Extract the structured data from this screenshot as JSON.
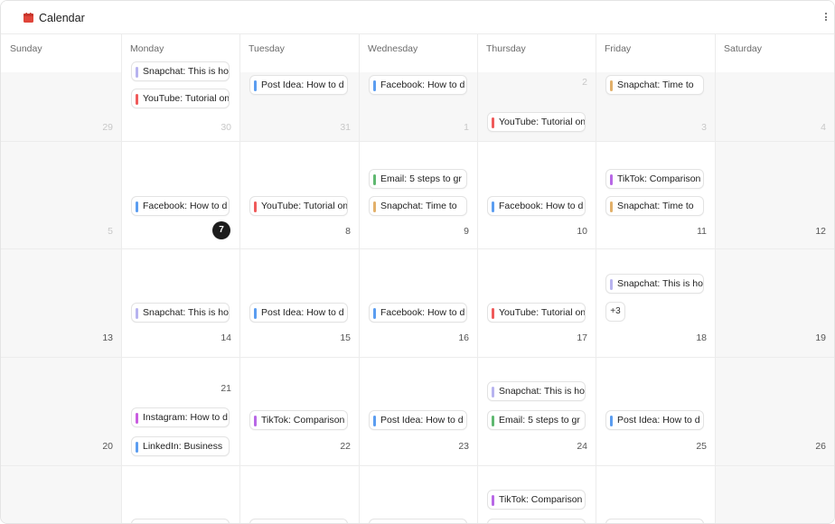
{
  "header": {
    "title": "Calendar"
  },
  "colors": {
    "facebook": "#5b9df0",
    "youtube": "#ef5a5a",
    "snapchat": "#b7b3ef",
    "email": "#5fb870",
    "snapchat_time": "#e2b06a",
    "tiktok": "#b868e6",
    "post": "#5b9df0",
    "instagram": "#c95ce0",
    "linkedin": "#5b9df0"
  },
  "weekdays": [
    "Sunday",
    "Monday",
    "Tuesday",
    "Wednesday",
    "Thursday",
    "Friday",
    "Saturday"
  ],
  "weeks": [
    {
      "days": [
        {
          "num": "29",
          "muted": true
        },
        {
          "num": "30",
          "muted": true
        },
        {
          "num": "31",
          "muted": true
        },
        {
          "num": "1",
          "muted": true
        },
        {
          "num": "2",
          "muted": true
        },
        {
          "num": "3",
          "muted": true
        },
        {
          "num": "4",
          "muted": true
        }
      ]
    },
    {
      "days": [
        {
          "num": "5",
          "muted": true
        },
        {
          "num": "7",
          "today": true
        },
        {
          "num": "8"
        },
        {
          "num": "9"
        },
        {
          "num": "10"
        },
        {
          "num": "11"
        },
        {
          "num": "12"
        }
      ]
    },
    {
      "days": [
        {
          "num": "13"
        },
        {
          "num": "14"
        },
        {
          "num": "15"
        },
        {
          "num": "16"
        },
        {
          "num": "17"
        },
        {
          "num": "18"
        },
        {
          "num": "19"
        }
      ]
    },
    {
      "days": [
        {
          "num": "20"
        },
        {
          "num": "21"
        },
        {
          "num": "22"
        },
        {
          "num": "23"
        },
        {
          "num": "24"
        },
        {
          "num": "25"
        },
        {
          "num": "26"
        }
      ]
    }
  ],
  "events": [
    {
      "label": "Snapchat: This is ho",
      "color": "snapchat"
    },
    {
      "label": "YouTube: Tutorial on",
      "color": "youtube"
    },
    {
      "label": "Post Idea: How to d",
      "color": "post"
    },
    {
      "label": "Facebook: How to d",
      "color": "facebook"
    },
    {
      "label": "YouTube: Tutorial on",
      "color": "youtube"
    },
    {
      "label": "Snapchat: Time to",
      "color": "snapchat_time"
    },
    {
      "label": "Facebook: How to d",
      "color": "facebook"
    },
    {
      "label": "YouTube: Tutorial on",
      "color": "youtube"
    },
    {
      "label": "Email: 5 steps to gr",
      "color": "email"
    },
    {
      "label": "Snapchat: Time to",
      "color": "snapchat_time"
    },
    {
      "label": "Facebook: How to d",
      "color": "facebook"
    },
    {
      "label": "TikTok: Comparison",
      "color": "tiktok"
    },
    {
      "label": "Snapchat: Time to",
      "color": "snapchat_time"
    },
    {
      "label": "Snapchat: This is ho",
      "color": "snapchat"
    },
    {
      "label": "Post Idea: How to d",
      "color": "post"
    },
    {
      "label": "Facebook: How to d",
      "color": "facebook"
    },
    {
      "label": "YouTube: Tutorial on",
      "color": "youtube"
    },
    {
      "label": "Snapchat: This is ho",
      "color": "snapchat"
    },
    {
      "label": "Instagram: How to d",
      "color": "instagram"
    },
    {
      "label": "LinkedIn: Business",
      "color": "linkedin"
    },
    {
      "label": "TikTok: Comparison",
      "color": "tiktok"
    },
    {
      "label": "Post Idea: How to d",
      "color": "post"
    },
    {
      "label": "Snapchat: This is ho",
      "color": "snapchat"
    },
    {
      "label": "Email: 5 steps to gr",
      "color": "email"
    },
    {
      "label": "Post Idea: How to d",
      "color": "post"
    },
    {
      "label": "TikTok: Comparison",
      "color": "tiktok"
    },
    {
      "label": "",
      "color": "youtube"
    },
    {
      "label": "",
      "color": "facebook"
    },
    {
      "label": "",
      "color": "youtube"
    },
    {
      "label": "",
      "color": "facebook"
    },
    {
      "label": "",
      "color": "facebook"
    }
  ],
  "more": "+3"
}
